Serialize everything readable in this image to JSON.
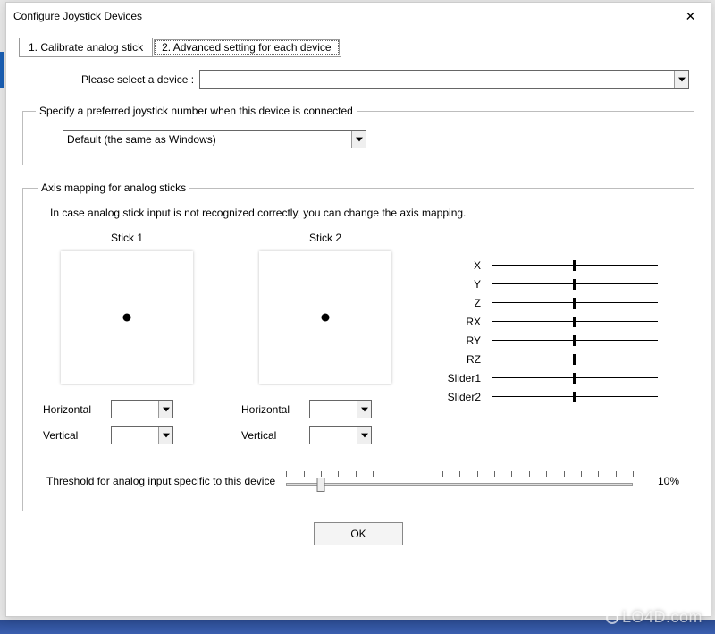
{
  "window": {
    "title": "Configure Joystick Devices"
  },
  "tabs": {
    "t1": "1. Calibrate analog stick",
    "t2": "2. Advanced setting for each device"
  },
  "select_device": {
    "label": "Please select a device :",
    "value": ""
  },
  "pref_group": {
    "legend": "Specify a preferred joystick number when this device is connected",
    "value": "Default (the same as Windows)"
  },
  "axis_group": {
    "legend": "Axis mapping for analog sticks",
    "hint": "In case analog stick input is not recognized correctly, you can change the axis mapping."
  },
  "sticks": {
    "stick1": {
      "title": "Stick 1",
      "horizontal_label": "Horizontal",
      "vertical_label": "Vertical",
      "h_value": "",
      "v_value": ""
    },
    "stick2": {
      "title": "Stick 2",
      "horizontal_label": "Horizontal",
      "vertical_label": "Vertical",
      "h_value": "",
      "v_value": ""
    }
  },
  "axes": [
    {
      "name": "X",
      "value": 50
    },
    {
      "name": "Y",
      "value": 50
    },
    {
      "name": "Z",
      "value": 50
    },
    {
      "name": "RX",
      "value": 50
    },
    {
      "name": "RY",
      "value": 50
    },
    {
      "name": "RZ",
      "value": 50
    },
    {
      "name": "Slider1",
      "value": 50
    },
    {
      "name": "Slider2",
      "value": 50
    }
  ],
  "threshold": {
    "label": "Threshold for analog input specific to this device",
    "value": 10,
    "display": "10%"
  },
  "ok_label": "OK",
  "watermark": "LO4D.com"
}
